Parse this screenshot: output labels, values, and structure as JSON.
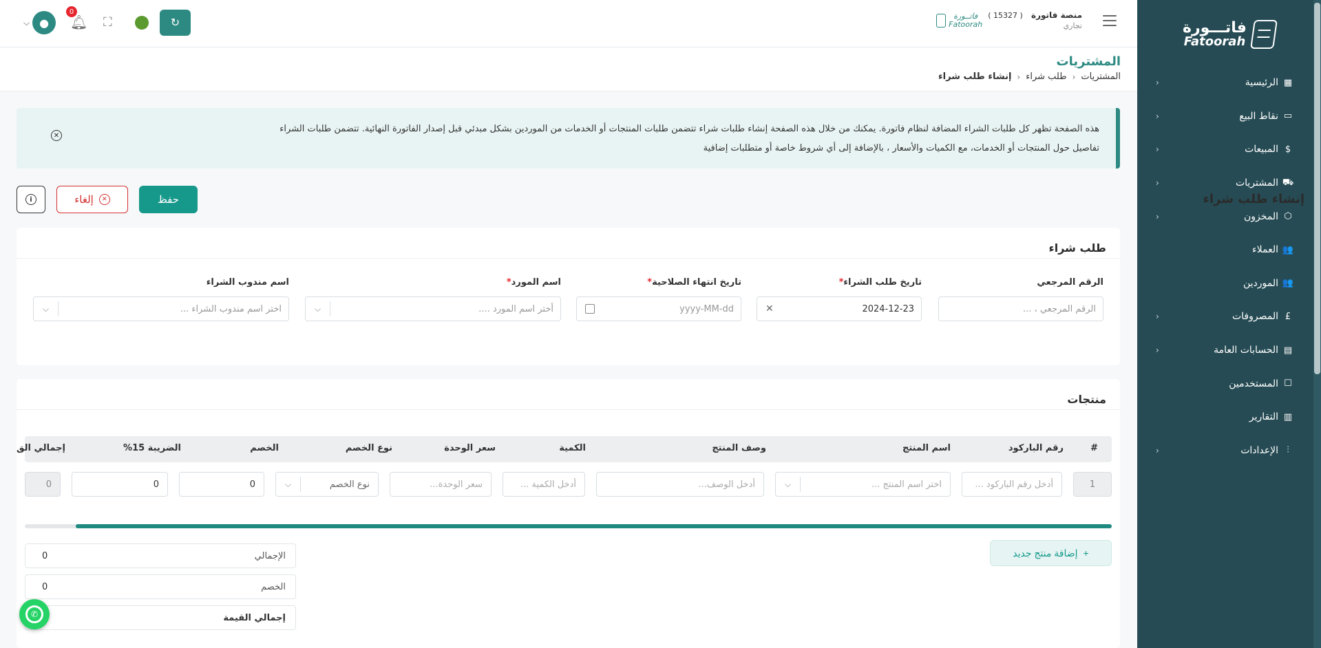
{
  "sidebar": {
    "logo_ar": "فاتـــورة",
    "logo_en": "Fatoorah",
    "items": [
      {
        "label": "الرئيسية",
        "icon": "grid-icon",
        "glyph": "▦",
        "has_children": true
      },
      {
        "label": "نقاط البيع",
        "icon": "monitor-icon",
        "glyph": "▭",
        "has_children": true
      },
      {
        "label": "المبيعات",
        "icon": "dollar-icon",
        "glyph": "$",
        "has_children": true
      },
      {
        "label": "المشتريات",
        "icon": "cart-icon",
        "glyph": "⛟",
        "has_children": true
      },
      {
        "label": "المخزون",
        "icon": "box-icon",
        "glyph": "⬡",
        "has_children": true
      },
      {
        "label": "العملاء",
        "icon": "users-icon",
        "glyph": "👥",
        "has_children": false
      },
      {
        "label": "الموردين",
        "icon": "suppliers-icon",
        "glyph": "👥",
        "has_children": false
      },
      {
        "label": "المصروفات",
        "icon": "pound-icon",
        "glyph": "£",
        "has_children": true
      },
      {
        "label": "الحسابات العامة",
        "icon": "calculator-icon",
        "glyph": "▤",
        "has_children": true
      },
      {
        "label": "المستخدمين",
        "icon": "user-card-icon",
        "glyph": "☐",
        "has_children": false
      },
      {
        "label": "التقارير",
        "icon": "bar-chart-icon",
        "glyph": "▥",
        "has_children": false
      },
      {
        "label": "الإعدادات",
        "icon": "sliders-icon",
        "glyph": "⫶",
        "has_children": true
      }
    ]
  },
  "topbar": {
    "company_name": "منصة فاتورة",
    "company_id": "( 15327 )",
    "company_type": "تجاري",
    "company_logo_ar": "فاتــورة",
    "company_logo_en": "Fatoorah",
    "notifications_count": "0"
  },
  "page": {
    "title": "المشتريات",
    "breadcrumb": [
      "المشتريات",
      "طلب شراء",
      "إنشاء طلب شراء"
    ]
  },
  "banner": {
    "line1": "هذه الصفحة تظهر كل طلبات الشراء المضافة لنظام فاتورة. يمكنك من خلال هذه الصفحة إنشاء طلبات شراء تتضمن طلبات المنتجات أو الخدمات من الموردين بشكل مبدئي قبل إصدار الفاتورة النهائية. تتضمن طلبات الشراء",
    "line2": "تفاصيل حول المنتجات أو الخدمات، مع الكميات والأسعار ، بالإضافة إلى أي شروط خاصة أو متطلبات إضافية"
  },
  "form": {
    "title": "إنشاء طلب شراء",
    "save_label": "حفظ",
    "cancel_label": "إلغاء"
  },
  "po_card": {
    "title": "طلب شراء",
    "fields": {
      "reference": {
        "label": "الرقم المرجعي",
        "placeholder": "الرقم المرجعي ، ..."
      },
      "order_date": {
        "label": "تاريخ طلب الشراء",
        "required": "*",
        "value": "2024-12-23"
      },
      "expiry_date": {
        "label": "تاريخ انتهاء الصلاحية",
        "required": "*",
        "placeholder": "yyyy-MM-dd"
      },
      "supplier": {
        "label": "اسم المورد",
        "required": "*",
        "placeholder": "أختر اسم المورد ...."
      },
      "rep": {
        "label": "اسم مندوب الشراء",
        "placeholder": "اختر اسم مندوب الشراء ..."
      }
    }
  },
  "products_card": {
    "title": "منتجات",
    "columns": [
      "#",
      "رقم الباركود",
      "اسم المنتج",
      "وصف المنتج",
      "الكمية",
      "سعر الوحدة",
      "نوع الخصم",
      "الخصم",
      "الضريبة 15%",
      "إجمالي الق"
    ],
    "row": {
      "index": "1",
      "barcode_placeholder": "أدخل رقم الباركود ...",
      "product_placeholder": "اختر اسم المنتج ...",
      "desc_placeholder": "أدخل الوصف...",
      "qty_placeholder": "أدخل الكمية ...",
      "price_placeholder": "سعر الوحدة...",
      "discount_type_placeholder": "نوع الخصم",
      "discount_value": "0",
      "tax_value": "0",
      "total_value": "0"
    },
    "add_label": "إضافة منتج جديد",
    "summary": {
      "total_label": "الإجمالي",
      "total_value": "0",
      "discount_label": "الخصم",
      "discount_value": "0",
      "grand_label": "إجمالي القيمة"
    }
  }
}
